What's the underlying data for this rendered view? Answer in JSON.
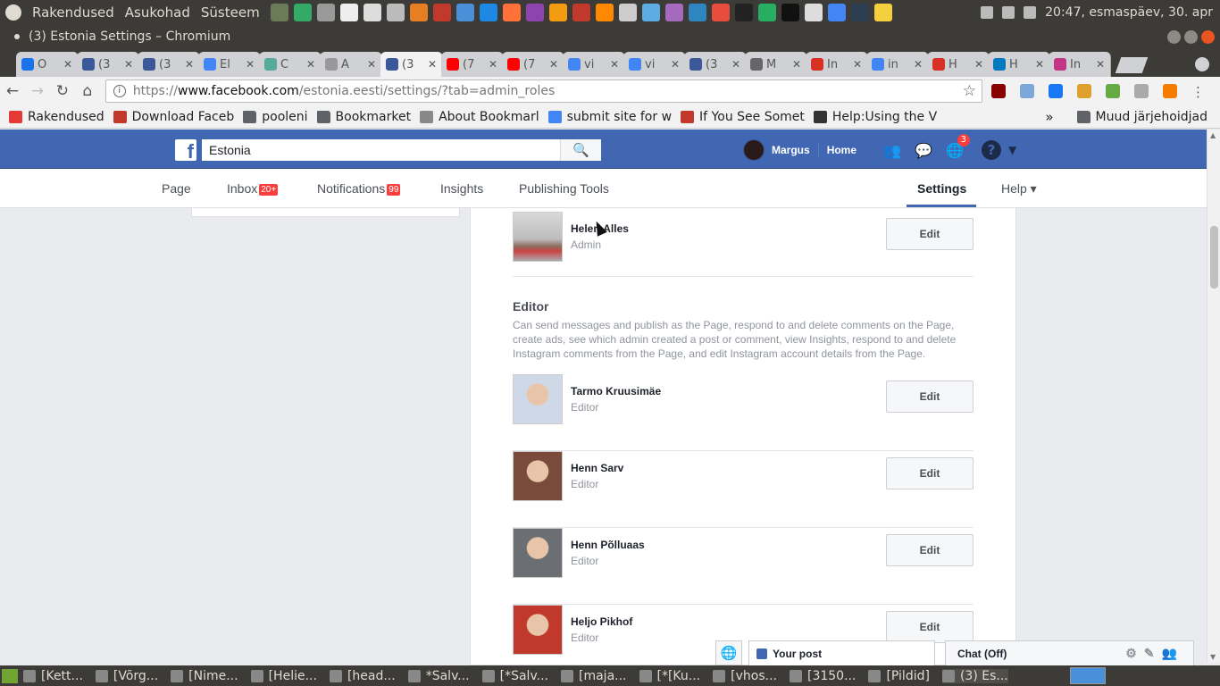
{
  "os_panel": {
    "menus": [
      "Rakendused",
      "Asukohad",
      "Süsteem"
    ],
    "clock": "20:47, esmaspäev, 30. apr"
  },
  "window": {
    "title": "(3) Estonia Settings – Chromium"
  },
  "tabs": [
    {
      "label": "O",
      "color": "#1a73e8"
    },
    {
      "label": "(3",
      "color": "#3b5998"
    },
    {
      "label": "(3",
      "color": "#3b5998"
    },
    {
      "label": "El",
      "color": "#4285f4"
    },
    {
      "label": "C",
      "color": "#5a9"
    },
    {
      "label": "A",
      "color": "#999"
    },
    {
      "label": "(3",
      "color": "#3b5998",
      "active": true
    },
    {
      "label": "(7",
      "color": "#ff0000"
    },
    {
      "label": "(7",
      "color": "#ff0000"
    },
    {
      "label": "vi",
      "color": "#4285f4"
    },
    {
      "label": "vi",
      "color": "#4285f4"
    },
    {
      "label": "(3",
      "color": "#3b5998"
    },
    {
      "label": "M",
      "color": "#666"
    },
    {
      "label": "In",
      "color": "#d93025"
    },
    {
      "label": "in",
      "color": "#4285f4"
    },
    {
      "label": "H",
      "color": "#d93025"
    },
    {
      "label": "H",
      "color": "#0079bf"
    },
    {
      "label": "In",
      "color": "#c13584"
    }
  ],
  "address_bar": {
    "scheme": "https://",
    "host": "www.facebook.com",
    "path": "/estonia.eesti/settings/?tab=admin_roles"
  },
  "bookmarks": [
    {
      "label": "Rakendused",
      "icon": "apps-grid-icon"
    },
    {
      "label": "Download Faceb",
      "icon": "site-icon"
    },
    {
      "label": "pooleni",
      "icon": "folder-icon"
    },
    {
      "label": "Bookmarket",
      "icon": "folder-icon"
    },
    {
      "label": "About Bookmarl",
      "icon": "page-icon"
    },
    {
      "label": "submit site for w",
      "icon": "google-icon"
    },
    {
      "label": "If You See Somet",
      "icon": "site-icon"
    },
    {
      "label": "Help:Using the V",
      "icon": "wikipedia-icon"
    }
  ],
  "bookmarks_other": "Muud järjehoidjad",
  "bookmarks_more": "»",
  "fb": {
    "search_value": "Estonia",
    "user_name": "Margus",
    "home": "Home",
    "notif_count": "3"
  },
  "page_nav": {
    "page": "Page",
    "inbox": "Inbox",
    "inbox_count": "20+",
    "notifications": "Notifications",
    "notifications_count": "99",
    "insights": "Insights",
    "publishing_tools": "Publishing Tools",
    "settings": "Settings",
    "help": "Help ▾"
  },
  "roles": {
    "top_person": {
      "name": "Heleri Alles",
      "role": "Admin",
      "edit": "Edit"
    },
    "editor_heading": "Editor",
    "editor_desc": "Can send messages and publish as the Page, respond to and delete comments on the Page, create ads, see which admin created a post or comment, view Insights, respond to and delete Instagram comments from the Page, and edit Instagram account details from the Page.",
    "editors": [
      {
        "name": "Tarmo Kruusimäe",
        "role": "Editor",
        "edit": "Edit",
        "photo_color": "#cfd8e6"
      },
      {
        "name": "Henn Sarv",
        "role": "Editor",
        "edit": "Edit",
        "photo_color": "#7a4a3a"
      },
      {
        "name": "Henn Põlluaas",
        "role": "Editor",
        "edit": "Edit",
        "photo_color": "#6b6f73"
      },
      {
        "name": "Heljo Pikhof",
        "role": "Editor",
        "edit": "Edit",
        "photo_color": "#c0392b"
      }
    ]
  },
  "chat": {
    "your_post": "Your post",
    "chat_off": "Chat (Off)"
  },
  "taskbar": [
    {
      "label": "[Kett..."
    },
    {
      "label": "[Võrg..."
    },
    {
      "label": "[Nime..."
    },
    {
      "label": "[Helie..."
    },
    {
      "label": "[head..."
    },
    {
      "label": "*Salv..."
    },
    {
      "label": "[*Salv..."
    },
    {
      "label": "[maja..."
    },
    {
      "label": "[*[Ku..."
    },
    {
      "label": "[vhos..."
    },
    {
      "label": "[3150..."
    },
    {
      "label": "[Pildid]"
    },
    {
      "label": "(3) Es..."
    }
  ]
}
